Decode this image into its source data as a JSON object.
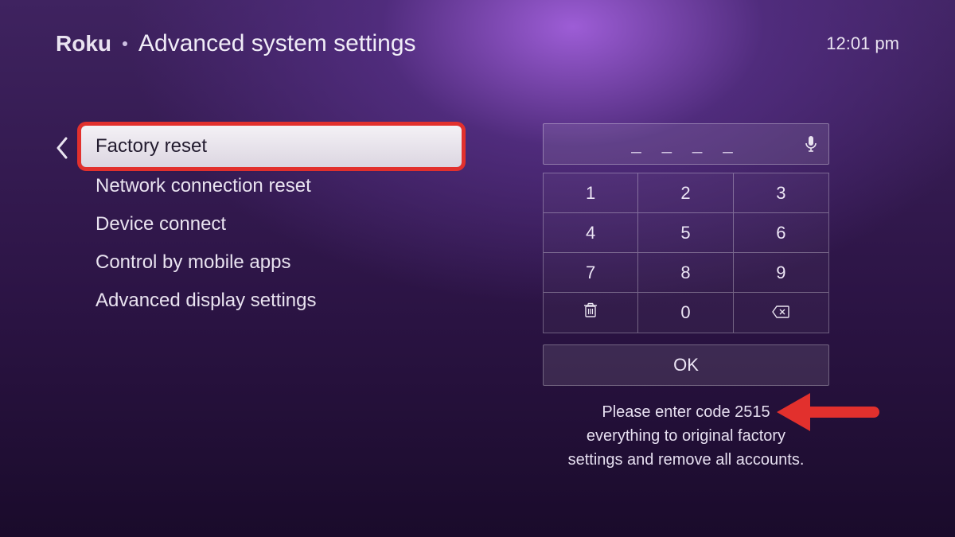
{
  "header": {
    "logo_text": "Roku",
    "page_title": "Advanced system settings",
    "time": "12:01 pm"
  },
  "menu": {
    "items": [
      {
        "label": "Factory reset",
        "highlighted": true
      },
      {
        "label": "Network connection reset"
      },
      {
        "label": "Device connect"
      },
      {
        "label": "Control by mobile apps"
      },
      {
        "label": "Advanced display settings"
      }
    ]
  },
  "keypad": {
    "entered_value": "",
    "placeholder_dashes": "_ _ _ _",
    "keys_row1": [
      "1",
      "2",
      "3"
    ],
    "keys_row2": [
      "4",
      "5",
      "6"
    ],
    "keys_row3": [
      "7",
      "8",
      "9"
    ],
    "zero": "0",
    "ok_label": "OK"
  },
  "instruction": {
    "line1": "Please enter code 2515",
    "line2": "everything to original factory",
    "line3": "settings and remove all accounts.",
    "code": "2515"
  }
}
